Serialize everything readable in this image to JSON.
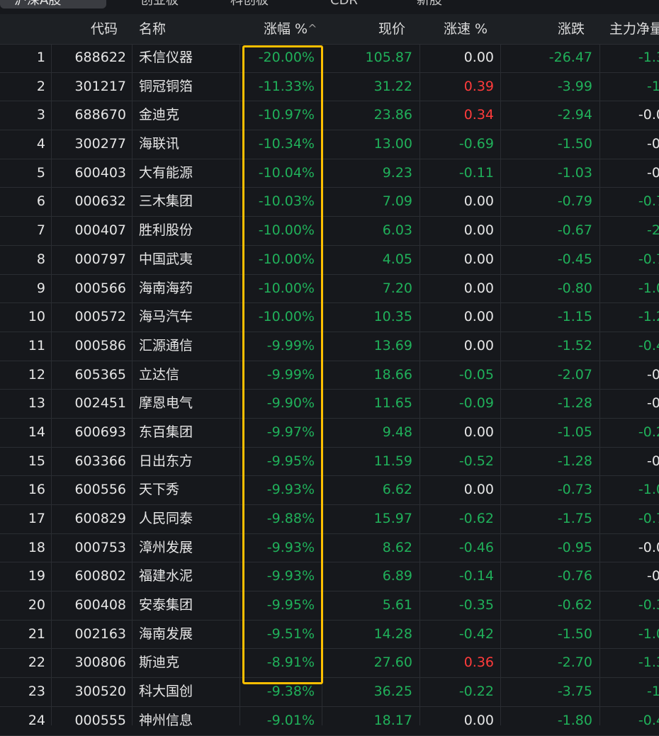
{
  "tabs": [
    {
      "label": "沪深A股",
      "active": true
    },
    {
      "label": "创业板",
      "active": false
    },
    {
      "label": "科创板",
      "active": false
    },
    {
      "label": "CDR",
      "active": false
    },
    {
      "label": "新股",
      "active": false
    }
  ],
  "columns": {
    "code": "代码",
    "name": "名称",
    "pct": "涨幅 %",
    "price": "现价",
    "speed": "涨速 %",
    "change": "涨跌",
    "main": "主力净量"
  },
  "sort_icon": "^",
  "colors": {
    "up": "#ff3b3b",
    "down": "#20b05a",
    "flat": "#e6e6e6",
    "highlight": "#ffbf00"
  },
  "rows": [
    {
      "idx": "1",
      "code": "688622",
      "name": "禾信仪器",
      "pct": "-20.00%",
      "price": "105.87",
      "speed": "0.00",
      "change": "-26.47",
      "main": "-1.3"
    },
    {
      "idx": "2",
      "code": "301217",
      "name": "铜冠铜箔",
      "pct": "-11.33%",
      "price": "31.22",
      "speed": "0.39",
      "change": "-3.99",
      "main": "-1."
    },
    {
      "idx": "3",
      "code": "688670",
      "name": "金迪克",
      "pct": "-10.97%",
      "price": "23.86",
      "speed": "0.34",
      "change": "-2.94",
      "main": "-0.0"
    },
    {
      "idx": "4",
      "code": "300277",
      "name": "海联讯",
      "pct": "-10.34%",
      "price": "13.00",
      "speed": "-0.69",
      "change": "-1.50",
      "main": "-0."
    },
    {
      "idx": "5",
      "code": "600403",
      "name": "大有能源",
      "pct": "-10.04%",
      "price": "9.23",
      "speed": "-0.11",
      "change": "-1.03",
      "main": "-0."
    },
    {
      "idx": "6",
      "code": "000632",
      "name": "三木集团",
      "pct": "-10.03%",
      "price": "7.09",
      "speed": "0.00",
      "change": "-0.79",
      "main": "-0.7"
    },
    {
      "idx": "7",
      "code": "000407",
      "name": "胜利股份",
      "pct": "-10.00%",
      "price": "6.03",
      "speed": "0.00",
      "change": "-0.67",
      "main": "-2."
    },
    {
      "idx": "8",
      "code": "000797",
      "name": "中国武夷",
      "pct": "-10.00%",
      "price": "4.05",
      "speed": "0.00",
      "change": "-0.45",
      "main": "-0.7"
    },
    {
      "idx": "9",
      "code": "000566",
      "name": "海南海药",
      "pct": "-10.00%",
      "price": "7.20",
      "speed": "0.00",
      "change": "-0.80",
      "main": "-1.0"
    },
    {
      "idx": "10",
      "code": "000572",
      "name": "海马汽车",
      "pct": "-10.00%",
      "price": "10.35",
      "speed": "0.00",
      "change": "-1.15",
      "main": "-1.2"
    },
    {
      "idx": "11",
      "code": "000586",
      "name": "汇源通信",
      "pct": "-9.99%",
      "price": "13.69",
      "speed": "0.00",
      "change": "-1.52",
      "main": "-0.4"
    },
    {
      "idx": "12",
      "code": "605365",
      "name": "立达信",
      "pct": "-9.99%",
      "price": "18.66",
      "speed": "-0.05",
      "change": "-2.07",
      "main": "-0."
    },
    {
      "idx": "13",
      "code": "002451",
      "name": "摩恩电气",
      "pct": "-9.90%",
      "price": "11.65",
      "speed": "-0.09",
      "change": "-1.28",
      "main": "-0."
    },
    {
      "idx": "14",
      "code": "600693",
      "name": "东百集团",
      "pct": "-9.97%",
      "price": "9.48",
      "speed": "0.00",
      "change": "-1.05",
      "main": "-0.2"
    },
    {
      "idx": "15",
      "code": "603366",
      "name": "日出东方",
      "pct": "-9.95%",
      "price": "11.59",
      "speed": "-0.52",
      "change": "-1.28",
      "main": "-0."
    },
    {
      "idx": "16",
      "code": "600556",
      "name": "天下秀",
      "pct": "-9.93%",
      "price": "6.62",
      "speed": "0.00",
      "change": "-0.73",
      "main": "-1.0"
    },
    {
      "idx": "17",
      "code": "600829",
      "name": "人民同泰",
      "pct": "-9.88%",
      "price": "15.97",
      "speed": "-0.62",
      "change": "-1.75",
      "main": "-0.7"
    },
    {
      "idx": "18",
      "code": "000753",
      "name": "漳州发展",
      "pct": "-9.93%",
      "price": "8.62",
      "speed": "-0.46",
      "change": "-0.95",
      "main": "-0.0"
    },
    {
      "idx": "19",
      "code": "600802",
      "name": "福建水泥",
      "pct": "-9.93%",
      "price": "6.89",
      "speed": "-0.14",
      "change": "-0.76",
      "main": "-0."
    },
    {
      "idx": "20",
      "code": "600408",
      "name": "安泰集团",
      "pct": "-9.95%",
      "price": "5.61",
      "speed": "-0.35",
      "change": "-0.62",
      "main": "-0.3"
    },
    {
      "idx": "21",
      "code": "002163",
      "name": "海南发展",
      "pct": "-9.51%",
      "price": "14.28",
      "speed": "-0.42",
      "change": "-1.50",
      "main": "-1.0"
    },
    {
      "idx": "22",
      "code": "300806",
      "name": "斯迪克",
      "pct": "-8.91%",
      "price": "27.60",
      "speed": "0.36",
      "change": "-2.70",
      "main": "-1.3"
    },
    {
      "idx": "23",
      "code": "300520",
      "name": "科大国创",
      "pct": "-9.38%",
      "price": "36.25",
      "speed": "-0.22",
      "change": "-3.75",
      "main": "-1."
    },
    {
      "idx": "24",
      "code": "000555",
      "name": "神州信息",
      "pct": "-9.01%",
      "price": "18.17",
      "speed": "0.00",
      "change": "-1.80",
      "main": "-0.4"
    }
  ]
}
